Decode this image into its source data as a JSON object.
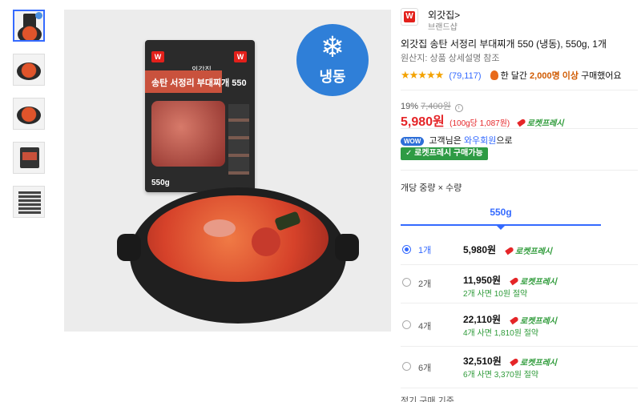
{
  "thumbnails": [
    {
      "name": "thumb-package"
    },
    {
      "name": "thumb-stew-1"
    },
    {
      "name": "thumb-stew-2"
    },
    {
      "name": "thumb-package-back"
    },
    {
      "name": "thumb-nutrition"
    }
  ],
  "main_image": {
    "frozen_label": "냉동",
    "pouch_brand": "외갓집",
    "pouch_title": "송탄 서정리 부대찌개 550",
    "pouch_weight": "550g"
  },
  "brand": {
    "name": "외갓집>",
    "shop": "브랜드샵",
    "logo_letter": "W",
    "color": "#e3201b"
  },
  "product": {
    "title": "외갓집 송탄 서정리 부대찌개 550 (냉동), 550g, 1개",
    "origin": "원산지: 상품 상세설명 참조",
    "stars": "★★★★★",
    "review_count": "(79,117)",
    "buy_note_prefix": "한 달간",
    "buy_note_count": "2,000명 이상",
    "buy_note_suffix": "구매했어요"
  },
  "price": {
    "discount": "19%",
    "original": "7,400원",
    "final": "5,980원",
    "unit": "(100g당 1,087원)",
    "rocket": "로켓프레시",
    "accent": "#e52528"
  },
  "wow": {
    "badge": "WOW",
    "text_prefix": "고객님은",
    "link": "와우회원",
    "text_suffix": "으로",
    "rocket_badge": "✓ 로켓프레시 구매가능"
  },
  "options": {
    "label": "개당 중량 × 수량",
    "tab": "550g",
    "items": [
      {
        "qty": "1개",
        "price": "5,980원",
        "rocket": "로켓프레시",
        "save": "",
        "selected": true
      },
      {
        "qty": "2개",
        "price": "11,950원",
        "rocket": "로켓프레시",
        "save": "2개 사면 10원 절약",
        "selected": false
      },
      {
        "qty": "4개",
        "price": "22,110원",
        "rocket": "로켓프레시",
        "save": "4개 사면 1,810원 절약",
        "selected": false
      },
      {
        "qty": "6개",
        "price": "32,510원",
        "rocket": "로켓프레시",
        "save": "6개 사면 3,370원 절약",
        "selected": false
      }
    ],
    "footer_cut": "정기 구매 기준"
  }
}
